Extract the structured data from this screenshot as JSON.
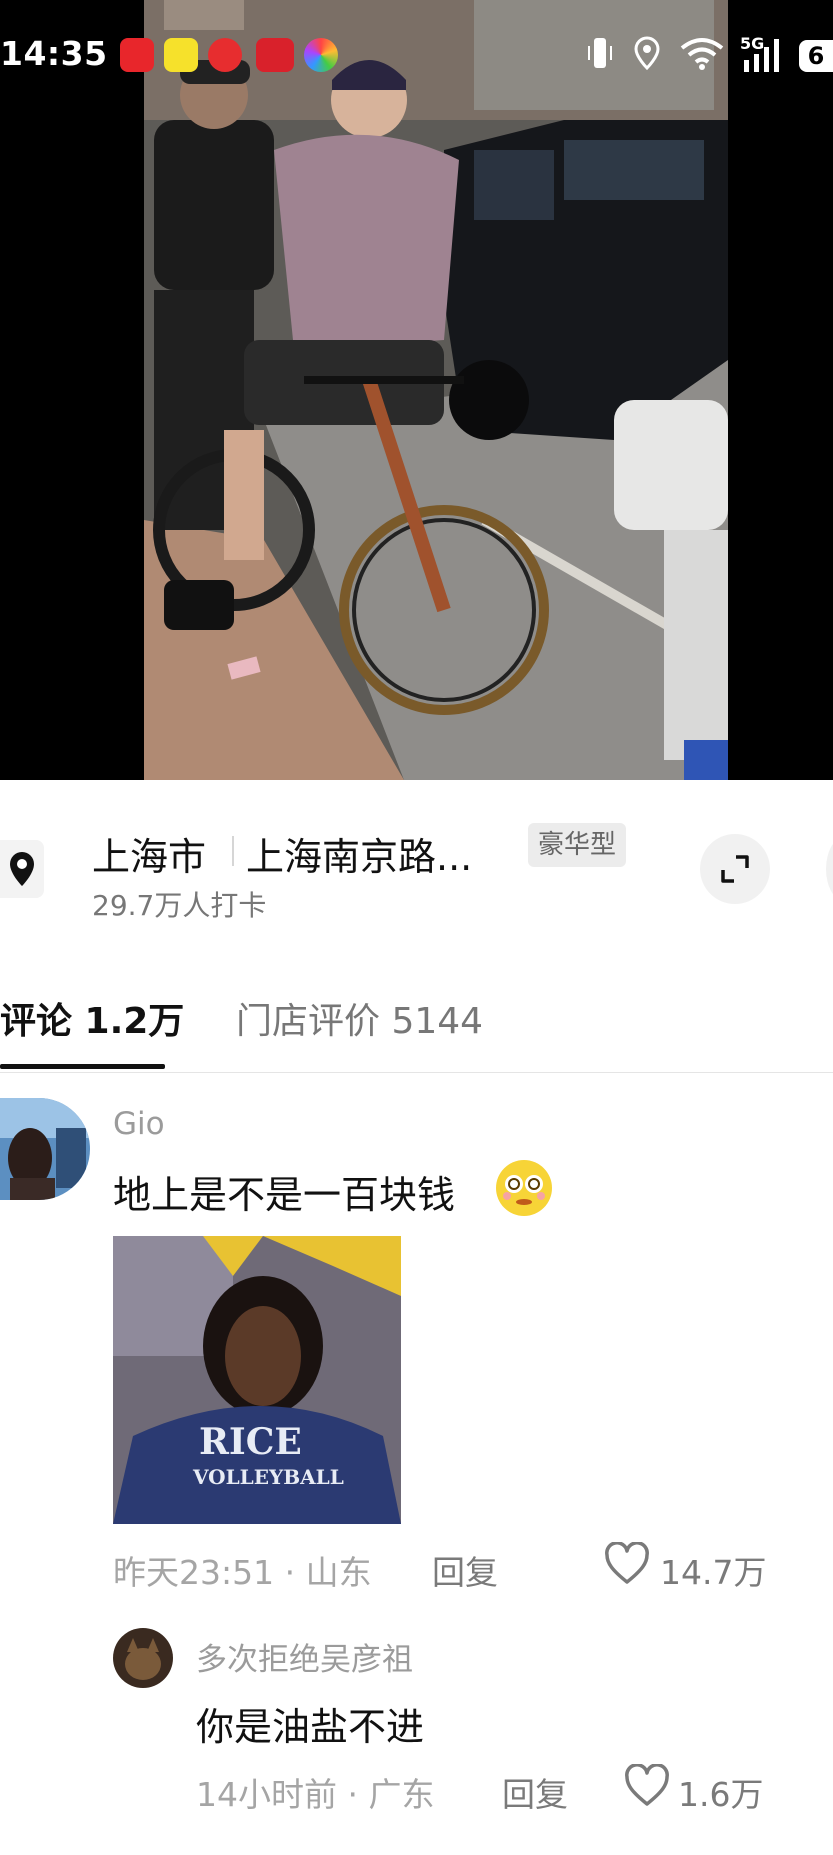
{
  "status_bar": {
    "time": "14:35",
    "network": "5G",
    "battery": "6",
    "app_icons": [
      "app-red-icon",
      "app-yellow-icon",
      "netease-music-icon",
      "app-red-rect-icon",
      "photos-flower-icon"
    ],
    "system_icons": [
      "vibrate-icon",
      "location-icon",
      "wifi-icon",
      "signal-icon"
    ]
  },
  "location": {
    "city": "上海市",
    "place": "上海南京路...",
    "tag": "豪华型",
    "checkins": "29.7万人打卡"
  },
  "tabs": {
    "comments": "评论 1.2万",
    "store_reviews": "门店评价 5144"
  },
  "comments": [
    {
      "user": "Gio",
      "text": "地上是不是一百块钱",
      "emoji": "dazed-face-emoji",
      "time": "昨天23:51 · 山东",
      "reply_label": "回复",
      "likes": "14.7万",
      "gif_text_line1": "RICE",
      "gif_text_line2": "VOLLEYBALL"
    },
    {
      "user": "多次拒绝吴彦祖",
      "text": "你是油盐不进",
      "time": "14小时前 · 广东",
      "reply_label": "回复",
      "likes": "1.6万"
    }
  ],
  "colors": {
    "text_primary": "#111111",
    "text_secondary": "#777777",
    "text_meta": "#a5a5a5",
    "tag_bg": "#ececec",
    "photo_bg": "#000000"
  }
}
